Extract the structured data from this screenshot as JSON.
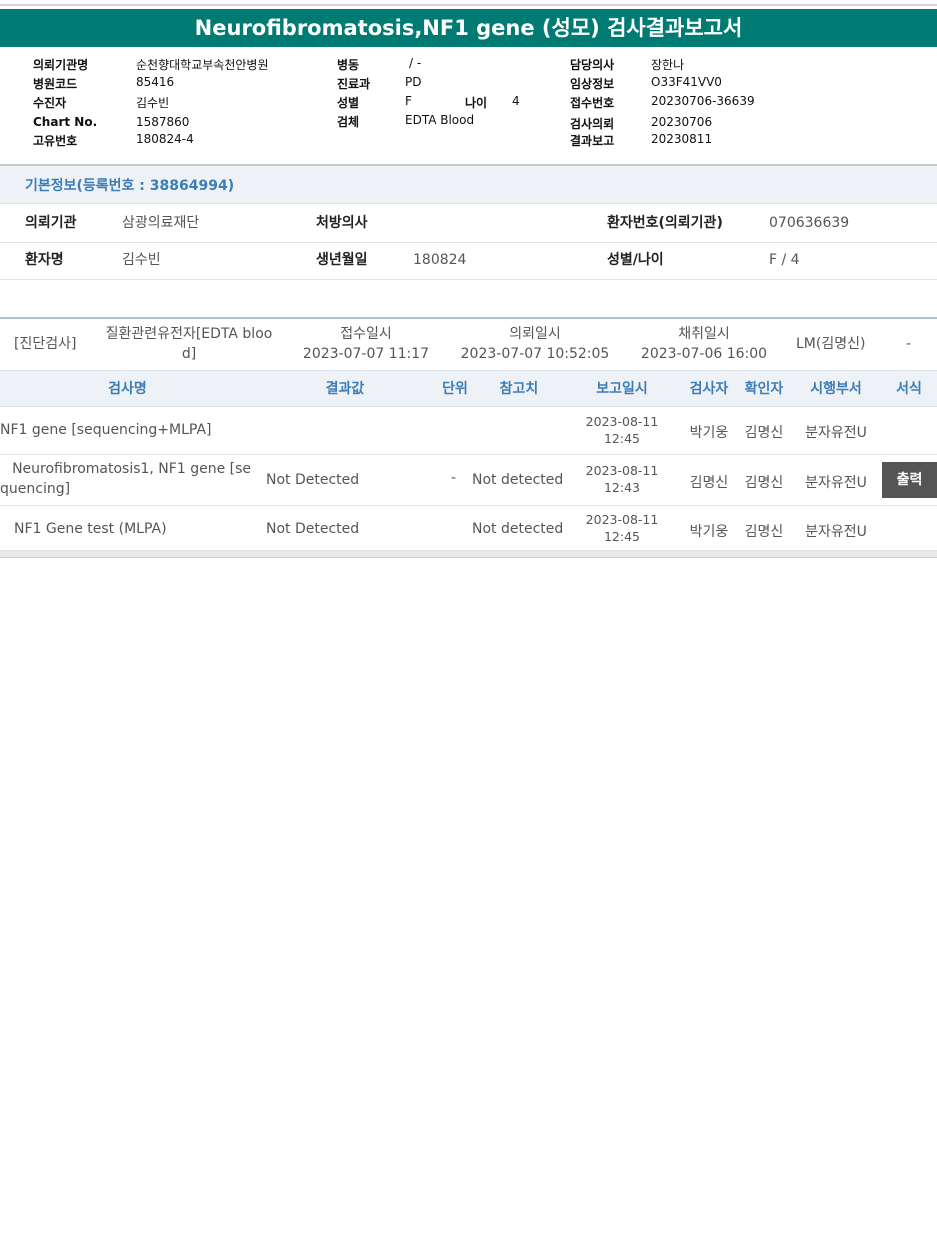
{
  "report": {
    "title": "Neurofibromatosis,NF1 gene (성모) 검사결과보고서",
    "fields": {
      "institution_label": "의뢰기관명",
      "institution": "순천향대학교부속천안병원",
      "hospital_code_label": "병원코드",
      "hospital_code": "85416",
      "examinee_label": "수진자",
      "examinee": "김수빈",
      "chart_no_label": "Chart No.",
      "chart_no": "1587860",
      "unique_no_label": "고유번호",
      "unique_no": "180824-4",
      "ward_label": "병동",
      "ward": "/ -",
      "department_label": "진료과",
      "department": "PD",
      "sex_label": "성별",
      "sex": "F",
      "age_label": "나이",
      "age": "4",
      "specimen_label": "검체",
      "specimen": "EDTA Blood",
      "doctor_label": "담당의사",
      "doctor": "장한나",
      "clinical_info_label": "임상정보",
      "clinical_info": "O33F41VV0",
      "receipt_no_label": "접수번호",
      "receipt_no": "20230706-36639",
      "request_label": "검사의뢰",
      "request_date": "20230706",
      "result_report_label": "결과보고",
      "result_report_date": "20230811"
    }
  },
  "basic_info": {
    "title": "기본정보(등록번호 : 38864994)",
    "referral_label": "의뢰기관",
    "referral": "삼광의료재단",
    "prescriber_label": "처방의사",
    "prescriber": "",
    "patient_no_label": "환자번호(의뢰기관)",
    "patient_no": "070636639",
    "patient_name_label": "환자명",
    "patient_name": "김수빈",
    "birth_label": "생년월일",
    "birth": "180824",
    "sex_age_label": "성별/나이",
    "sex_age": "F / 4"
  },
  "summary": {
    "category": "[진단검사]",
    "test_line1": "질환관련유전자[EDTA bloo",
    "test_line2": "d]",
    "receipt_label": "접수일시",
    "receipt_time": "2023-07-07 11:17",
    "request_label": "의뢰일시",
    "request_time": "2023-07-07 10:52:05",
    "collect_label": "채취일시",
    "collect_time": "2023-07-06 16:00",
    "lab": "LM(김명신)",
    "extra": "-"
  },
  "table": {
    "headers": [
      "검사명",
      "결과값",
      "단위",
      "참고치",
      "보고일시",
      "검사자",
      "확인자",
      "시행부서",
      "서식"
    ],
    "rows": [
      {
        "name": "NF1 gene [sequencing+MLPA]",
        "result": "",
        "unit": "",
        "ref": "",
        "date1": "2023-08-11",
        "date2": "12:45",
        "tester": "박기웅",
        "confirmer": "김명신",
        "dept": "분자유전U"
      },
      {
        "name_line1": "Neurofibromatosis1, NF1 gene [se",
        "name_line2": "quencing]",
        "result": "Not Detected",
        "unit": "-",
        "ref": "Not detected",
        "date1": "2023-08-11",
        "date2": "12:43",
        "tester": "김명신",
        "confirmer": "김명신",
        "dept": "분자유전U",
        "print_label": "출력"
      },
      {
        "name": "NF1 Gene test (MLPA)",
        "result": "Not Detected",
        "unit": "",
        "ref": "Not detected",
        "date1": "2023-08-11",
        "date2": "12:45",
        "tester": "박기웅",
        "confirmer": "김명신",
        "dept": "분자유전U"
      }
    ]
  }
}
